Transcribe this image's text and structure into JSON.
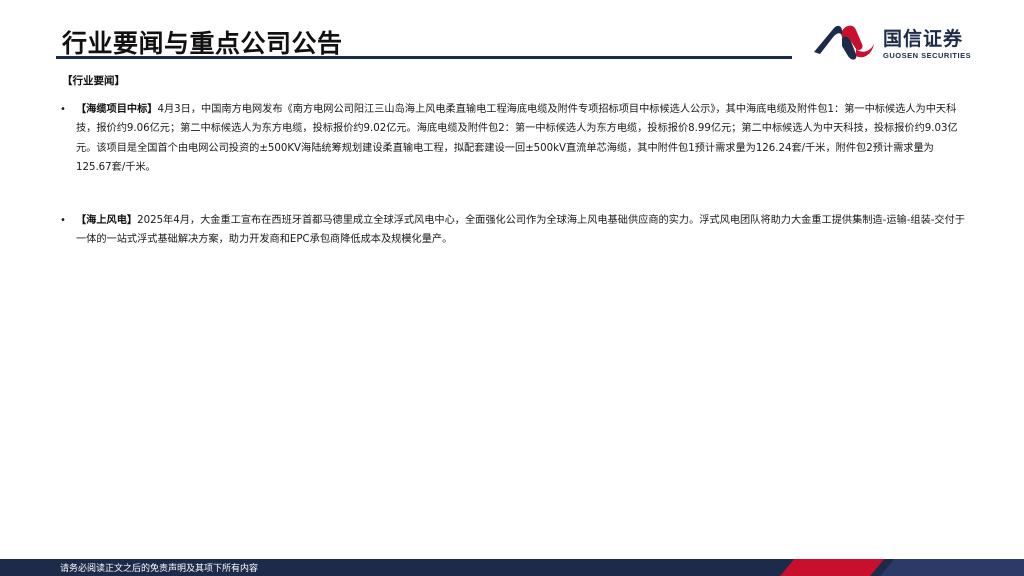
{
  "header": {
    "title": "行业要闻与重点公司公告",
    "logo_cn": "国信证券",
    "logo_en": "GUOSEN SECURITIES"
  },
  "section_label": "【行业要闻】",
  "news": [
    {
      "tag": "【海缆项目中标】",
      "text": "4月3日，中国南方电网发布《南方电网公司阳江三山岛海上风电柔直输电工程海底电缆及附件专项招标项目中标候选人公示》，其中海底电缆及附件包1：第一中标候选人为中天科技，报价约9.06亿元；第二中标候选人为东方电缆，投标报价约9.02亿元。海底电缆及附件包2：第一中标候选人为东方电缆，投标报价8.99亿元；第二中标候选人为中天科技，投标报价约9.03亿元。该项目是全国首个由电网公司投资的±500KV海陆统筹规划建设柔直输电工程，拟配套建设一回±500kV直流单芯海缆，其中附件包1预计需求量为126.24套/千米，附件包2预计需求量为125.67套/千米。"
    },
    {
      "tag": "【海上风电】",
      "text": "2025年4月，大金重工宣布在西班牙首都马德里成立全球浮式风电中心，全面强化公司作为全球海上风电基础供应商的实力。浮式风电团队将助力大金重工提供集制造-运输-组装-交付于一体的一站式浮式基础解决方案，助力开发商和EPC承包商降低成本及规模化量产。"
    }
  ],
  "footer": {
    "disclaimer": "请务必阅读正文之后的免责声明及其项下所有内容"
  },
  "colors": {
    "navy": "#1e2a4a",
    "red": "#c8102e"
  }
}
